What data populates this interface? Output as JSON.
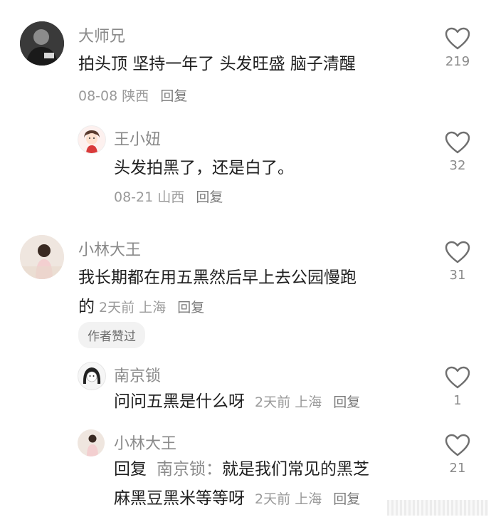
{
  "comments": [
    {
      "username": "大师兄",
      "text": "拍头顶 坚持一年了 头发旺盛 脑子清醒",
      "date": "08-08",
      "location": "陕西",
      "reply_label": "回复",
      "likes": "219"
    },
    {
      "username": "王小妞",
      "text": "头发拍黑了，还是白了。",
      "date": "08-21",
      "location": "山西",
      "reply_label": "回复",
      "likes": "32"
    },
    {
      "username": "小林大王",
      "text_line1": "我长期都在用五黑然后早上去公园慢跑",
      "text_line2": "的",
      "date": "2天前",
      "location": "上海",
      "reply_label": "回复",
      "likes": "31",
      "badge": "作者赞过"
    },
    {
      "username": "南京锁",
      "text": "问问五黑是什么呀",
      "date": "2天前",
      "location": "上海",
      "reply_label": "回复",
      "likes": "1"
    },
    {
      "username": "小林大王",
      "reply_prefix": "回复",
      "mention": "南京锁：",
      "text_line1": "就是我们常见的黑芝",
      "text_line2": "麻黑豆黑米等等呀",
      "date": "2天前",
      "location": "上海",
      "reply_label": "回复",
      "likes": "21"
    }
  ],
  "icons": {
    "like": "heart-outline-icon"
  }
}
